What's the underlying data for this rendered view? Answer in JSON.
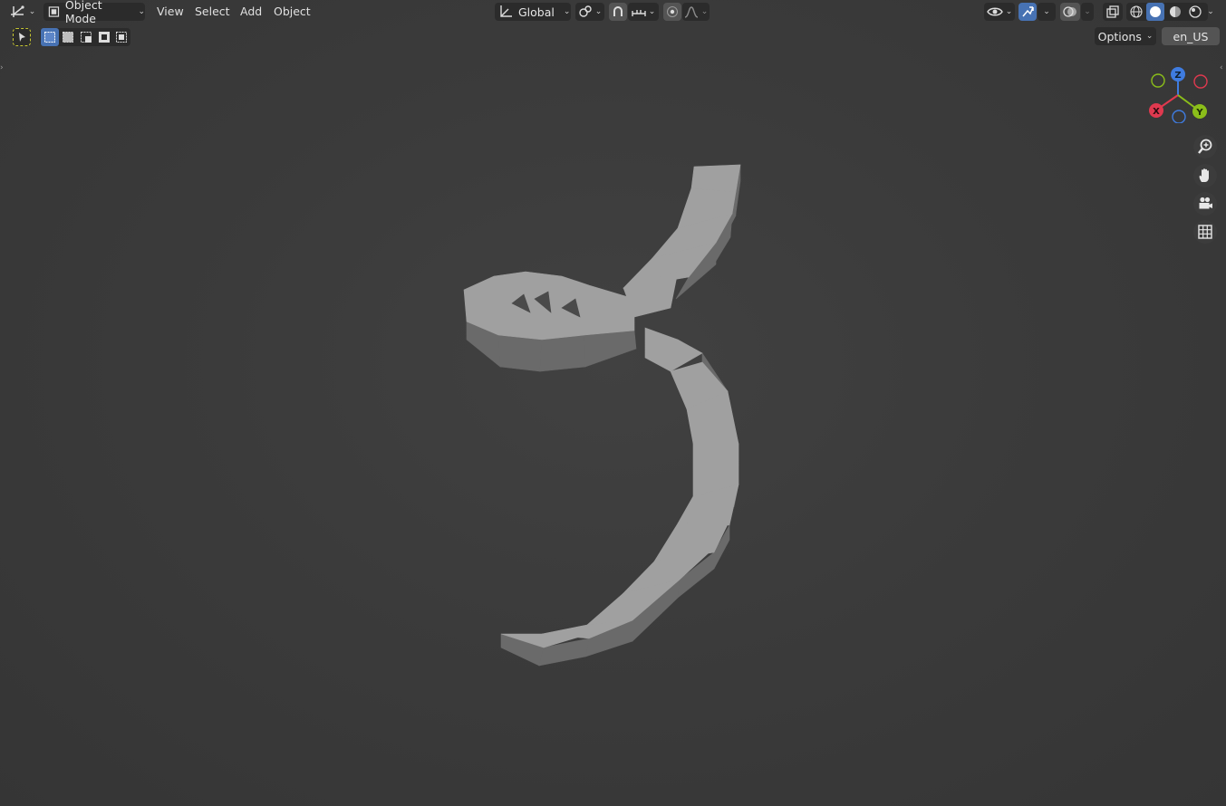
{
  "header": {
    "mode_label": "Object Mode",
    "menus": {
      "view": "View",
      "select": "Select",
      "add": "Add",
      "object": "Object"
    },
    "transform_orientation": "Global",
    "options_label": "Options",
    "language_label": "en_US"
  },
  "gizmo": {
    "axis_x": "X",
    "axis_y": "Y",
    "axis_z": "Z",
    "colors": {
      "x": "#e0394f",
      "y": "#8bbe1a",
      "z": "#3f7ce0"
    }
  },
  "navigation_icons": [
    "zoom-icon",
    "hand-pan-icon",
    "camera-icon",
    "grid-ortho-icon"
  ],
  "colors": {
    "viewport_bg": "#3d3d3d",
    "header_btn": "#2b2b2b",
    "active_blue": "#4772b3",
    "mesh_top": "#a0a0a0",
    "mesh_side": "#6a6a6a"
  }
}
